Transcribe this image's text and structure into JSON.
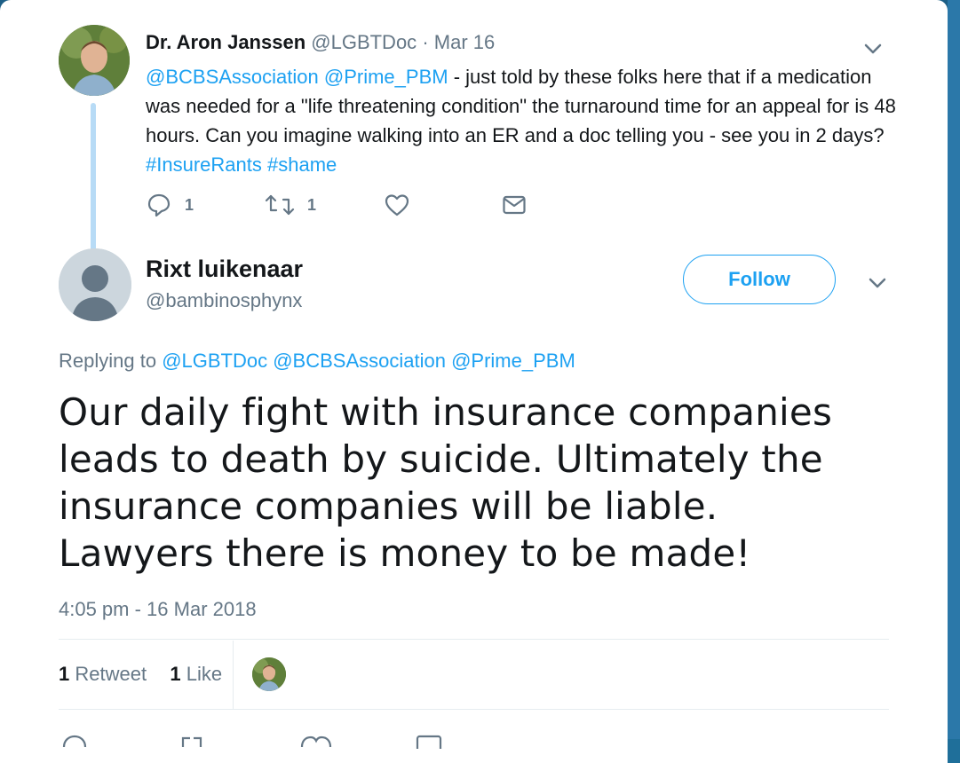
{
  "parent_tweet": {
    "author_name": "Dr. Aron Janssen",
    "handle": "@LGBTDoc",
    "separator": "·",
    "date": "Mar 16",
    "text_parts": {
      "mention1": "@BCBSAssociation",
      "space1": " ",
      "mention2": "@Prime_PBM",
      "body": " - just told by these folks here that if a medication was needed for a \"life threatening condition\" the turnaround time for an appeal for is 48 hours.  Can you imagine walking into an ER and a doc telling you - see you in 2 days? ",
      "hashtag1": "#InsureRants",
      "space2": " ",
      "hashtag2": "#shame"
    },
    "actions": {
      "reply_count": "1",
      "retweet_count": "1",
      "like_count": "",
      "reply_icon": "reply-icon",
      "retweet_icon": "retweet-icon",
      "like_icon": "heart-icon",
      "dm_icon": "envelope-icon"
    }
  },
  "main_tweet": {
    "author_name": "Rixt luikenaar",
    "handle": "@bambinosphynx",
    "follow_label": "Follow",
    "replying_prefix": "Replying to ",
    "replying_mentions": "@LGBTDoc @BCBSAssociation @Prime_PBM",
    "text": "Our daily fight with insurance companies leads to death by suicide. Ultimately the insurance companies will be liable. Lawyers there is money to be made!",
    "timestamp": "4:05 pm - 16 Mar 2018",
    "stats": {
      "retweets_count": "1",
      "retweets_label": "Retweet",
      "likes_count": "1",
      "likes_label": "Like"
    }
  },
  "colors": {
    "link": "#1da1f2",
    "muted": "#657786",
    "text": "#14171a",
    "thread_line": "#b7dbf6",
    "background_blue": "#1f6f9a"
  }
}
